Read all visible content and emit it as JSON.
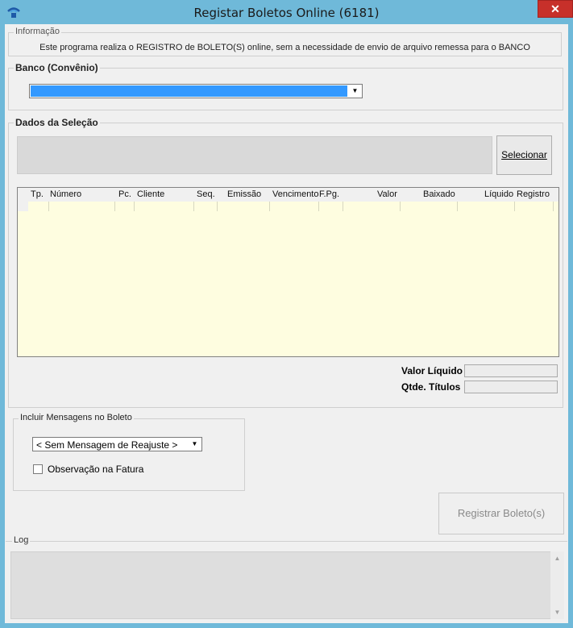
{
  "window": {
    "title": "Registar Boletos Online (6181)",
    "close_label": "✕"
  },
  "informacao": {
    "label": "Informação",
    "text": "Este programa realiza o REGISTRO de BOLETO(S) online, sem a necessidade de envio de arquivo remessa para o BANCO"
  },
  "banco": {
    "label": "Banco (Convênio)",
    "selected_value": ""
  },
  "selecao": {
    "label": "Dados da Seleção",
    "select_button": "Selecionar",
    "columns": [
      "Tp.",
      "Número",
      "Pc.",
      "Cliente",
      "Seq.",
      "Emissão",
      "Vencimento",
      "F.Pg.",
      "Valor",
      "Baixado",
      "Líquido",
      "Registro"
    ],
    "rows": []
  },
  "totais": {
    "valor_liquido_label": "Valor Líquido",
    "qtde_titulos_label": "Qtde. Títulos",
    "valor_liquido": "",
    "qtde_titulos": ""
  },
  "mensagens": {
    "label": "Incluir Mensagens no Boleto",
    "selected": "< Sem Mensagem de Reajuste >",
    "observacao_label": "Observação na Fatura",
    "observacao_checked": false
  },
  "actions": {
    "registrar_label": "Registrar Boleto(s)"
  },
  "log": {
    "label": "Log",
    "content": ""
  },
  "colors": {
    "title_bar": "#6fb9d9",
    "close": "#c7302a",
    "selection": "#3399ff",
    "grid_bg": "#fefde0"
  }
}
